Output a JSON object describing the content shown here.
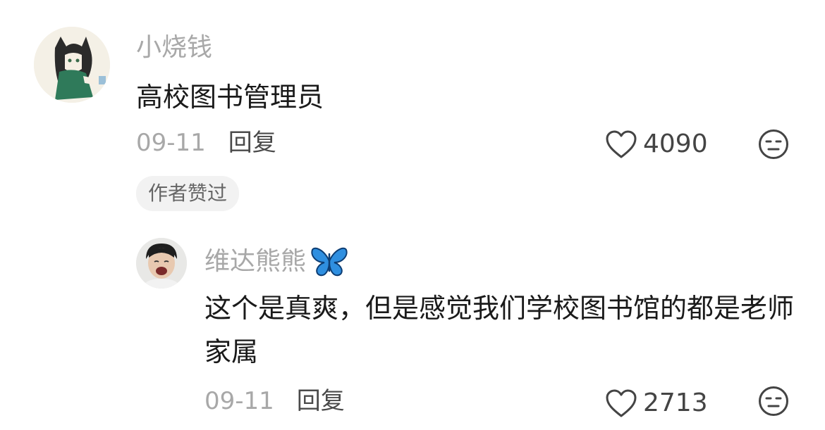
{
  "comment": {
    "username": "小烧钱",
    "text": "高校图书管理员",
    "date": "09-11",
    "reply_label": "回复",
    "likes": "4090",
    "author_badge": "作者赞过"
  },
  "reply": {
    "username": "维达熊熊",
    "username_emoji": "butterfly-icon",
    "text": "这个是真爽，但是感觉我们学校图书馆的都是老师家属",
    "date": "09-11",
    "reply_label": "回复",
    "likes": "2713"
  },
  "colors": {
    "username": "#a8a8a8",
    "text": "#1a1a1a",
    "meta": "#4a4a4a",
    "badge_bg": "#f2f2f2",
    "butterfly": "#2f8fe0"
  }
}
